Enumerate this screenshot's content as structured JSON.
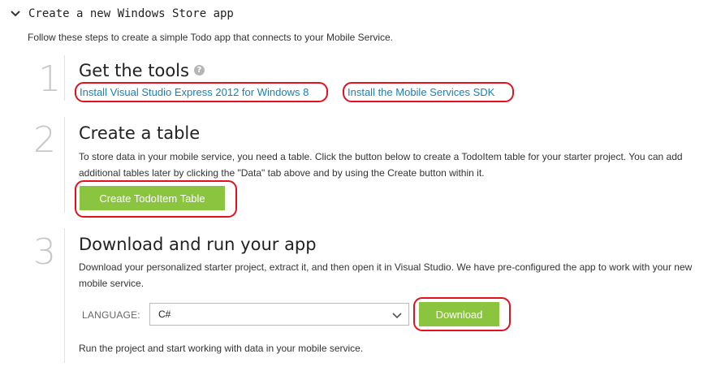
{
  "section": {
    "title": "Create a new Windows Store app",
    "intro": "Follow these steps to create a simple Todo app that connects to your Mobile Service."
  },
  "steps": [
    {
      "number": "1",
      "title": "Get the tools",
      "help_icon": "help-icon",
      "links": [
        "Install Visual Studio Express 2012 for Windows 8",
        "Install the Mobile Services SDK"
      ]
    },
    {
      "number": "2",
      "title": "Create a table",
      "description": "To store data in your mobile service, you need a table. Click the button below to create a TodoItem table for your starter project. You can add additional tables later by clicking the \"Data\" tab above and by using the Create button within it.",
      "button_label": "Create TodoItem Table"
    },
    {
      "number": "3",
      "title": "Download and run your app",
      "description": "Download your personalized starter project, extract it, and then open it in Visual Studio. We have pre-configured the app to work with your new mobile service.",
      "language_label": "LANGUAGE:",
      "language_value": "C#",
      "button_label": "Download",
      "footer": "Run the project and start working with data in your mobile service."
    }
  ],
  "colors": {
    "accent_green": "#8bc53f",
    "link_blue": "#1a7fb8",
    "highlight_red": "#e3111d"
  }
}
